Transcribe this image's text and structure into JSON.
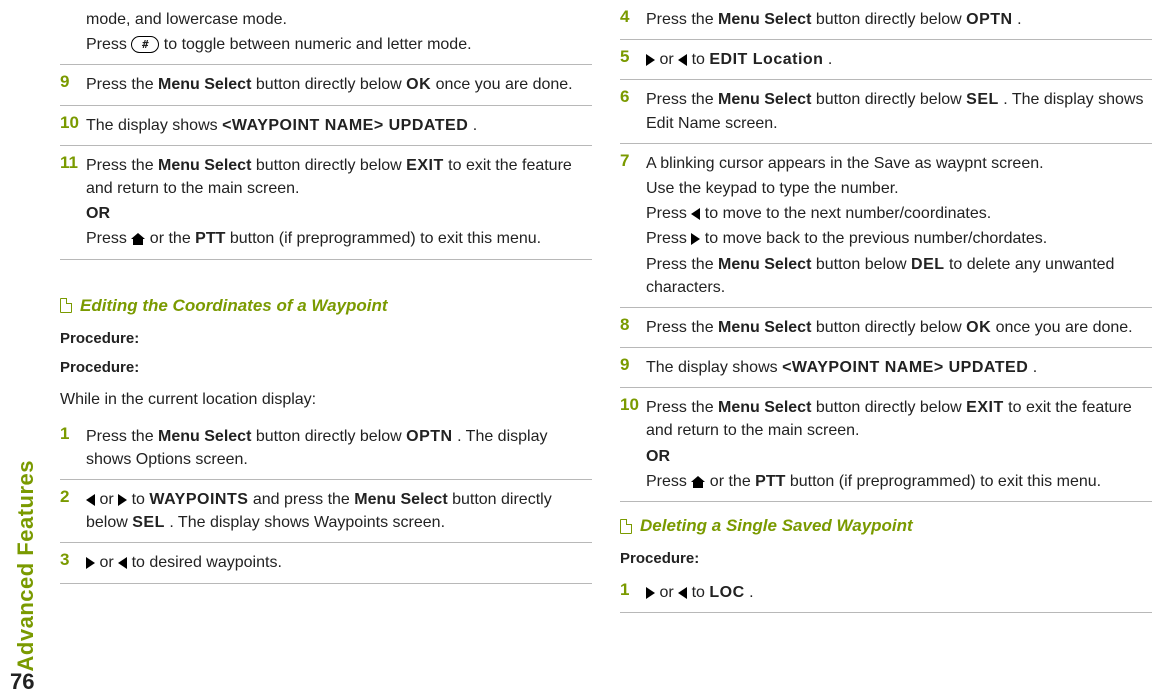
{
  "sidebar": {
    "section_title": "Advanced Features"
  },
  "page_number": "76",
  "left": {
    "pre_steps": {
      "line1": "mode, and lowercase mode.",
      "line2a": "Press ",
      "key_hash": "#",
      "line2b": " to toggle between numeric and letter mode."
    },
    "step9": {
      "num": "9",
      "a": "Press the ",
      "b": "Menu Select",
      "c": " button directly below ",
      "d": "OK",
      "e": " once you are done."
    },
    "step10": {
      "num": "10",
      "a": "The display shows ",
      "b": "<WAYPOINT NAME> UPDATED",
      "c": "."
    },
    "step11": {
      "num": "11",
      "a": "Press the ",
      "b": "Menu Select",
      "c": " button directly below ",
      "d": "EXIT",
      "e": " to exit the feature and return to the main screen.",
      "or": "OR",
      "f": "Press ",
      "g": " or the ",
      "h": "PTT",
      "i": " button (if preprogrammed) to exit this menu."
    },
    "section_title": "Editing the Coordinates of a Waypoint",
    "procedure": "Procedure:",
    "procedure2": "Procedure:",
    "intro": "While in the current location display:",
    "s1": {
      "num": "1",
      "a": "Press the ",
      "b": "Menu Select",
      "c": " button directly below ",
      "d": "OPTN",
      "e": ". The display shows Options screen."
    },
    "s2": {
      "num": "2",
      "a": " or ",
      "b": " to ",
      "c": "WAYPOINTS",
      "d": " and press the ",
      "e": "Menu Select",
      "f": " button directly below ",
      "g": "SEL",
      "h": ". The display shows Waypoints screen."
    },
    "s3": {
      "num": "3",
      "a": " or ",
      "b": "  to desired waypoints."
    }
  },
  "right": {
    "s4": {
      "num": "4",
      "a": "Press the ",
      "b": "Menu Select",
      "c": " button directly below ",
      "d": "OPTN",
      "e": "."
    },
    "s5": {
      "num": "5",
      "a": " or ",
      "b": "  to ",
      "c": "EDIT Location",
      "d": "."
    },
    "s6": {
      "num": "6",
      "a": "Press the ",
      "b": "Menu Select",
      "c": " button directly below ",
      "d": "SEL",
      "e": ". The display shows Edit Name screen."
    },
    "s7": {
      "num": "7",
      "l1": "A blinking cursor appears in the Save as waypnt screen.",
      "l2": "Use the keypad to type the number.",
      "l3a": "Press ",
      "l3b": " to move to the next number/coordinates.",
      "l4a": "Press ",
      "l4b": " to move back to the previous number/chordates.",
      "l5a": "Press the ",
      "l5b": "Menu Select",
      "l5c": " button below ",
      "l5d": "DEL",
      "l5e": " to delete any unwanted characters."
    },
    "s8": {
      "num": "8",
      "a": "Press the ",
      "b": "Menu Select",
      "c": " button directly below ",
      "d": "OK",
      "e": " once you are done."
    },
    "s9": {
      "num": "9",
      "a": "The display shows ",
      "b": "<WAYPOINT NAME> UPDATED",
      "c": "."
    },
    "s10": {
      "num": "10",
      "a": "Press the ",
      "b": "Menu Select",
      "c": " button directly below ",
      "d": "EXIT",
      "e": " to exit the feature and return to the main screen.",
      "or": "OR",
      "f": "Press ",
      "g": " or the ",
      "h": "PTT",
      "i": " button (if preprogrammed) to exit this menu."
    },
    "section_title": "Deleting a Single Saved Waypoint",
    "procedure": "Procedure:",
    "d1": {
      "num": "1",
      "a": " or ",
      "b": " to ",
      "c": "LOC",
      "d": "."
    }
  }
}
